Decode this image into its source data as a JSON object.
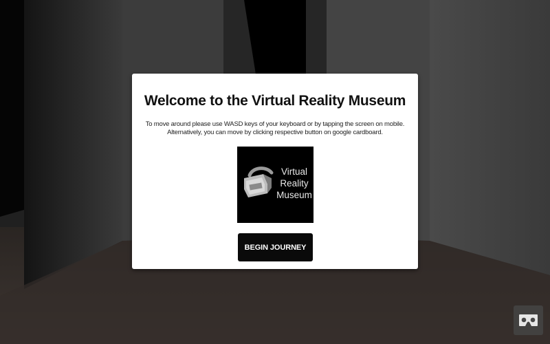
{
  "modal": {
    "title": "Welcome to the Virtual Reality Museum",
    "instructions": "To move around please use WASD keys of your keyboard or by tapping the screen on mobile. Alternatively, you can move by clicking respective button on google cardboard.",
    "logo": {
      "line1": "Virtual",
      "line2": "Reality",
      "line3": "Museum",
      "icon": "vr-headset-icon"
    },
    "begin_button_label": "BEGIN JOURNEY"
  },
  "vr_mode_button": {
    "icon": "cardboard-vr-icon"
  }
}
